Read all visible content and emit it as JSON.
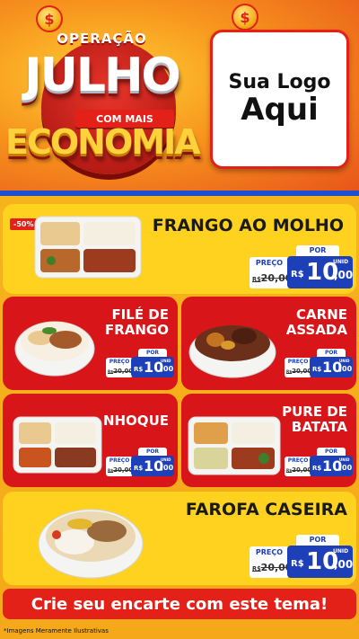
{
  "header": {
    "coin_symbol": "$",
    "logo": {
      "top": "OPERAÇÃO",
      "main": "JULHO",
      "ribbon": "COM MAIS",
      "bottom": "ECONOMIA"
    },
    "brand_box": {
      "line1": "Sua Logo",
      "line2": "Aqui"
    }
  },
  "colors": {
    "accent_red": "#e32119",
    "price_blue": "#1d3fb8",
    "card_yellow": "#ffd21f",
    "card_red": "#d8161a",
    "stripe_blue": "#1f4fd1"
  },
  "products": [
    {
      "name_lines": [
        "FRANGO AO MOLHO"
      ],
      "badge": "-50%",
      "por": "POR",
      "preco": "PREÇO",
      "old_prefix": "R$",
      "old": "20,00",
      "currency": "R$",
      "price": "10",
      "cents": ",00",
      "unit": "UNID"
    },
    {
      "name_lines": [
        "FILÉ DE",
        "FRANGO"
      ],
      "por": "POR",
      "preco": "PREÇO",
      "old_prefix": "R$",
      "old": "20,00",
      "currency": "R$",
      "price": "10",
      "cents": ",00",
      "unit": "UNID"
    },
    {
      "name_lines": [
        "CARNE",
        "ASSADA"
      ],
      "por": "POR",
      "preco": "PREÇO",
      "old_prefix": "R$",
      "old": "20,00",
      "currency": "R$",
      "price": "10",
      "cents": ",00",
      "unit": "UNID"
    },
    {
      "name_lines": [
        "NHOQUE"
      ],
      "por": "POR",
      "preco": "PREÇO",
      "old_prefix": "R$",
      "old": "20,00",
      "currency": "R$",
      "price": "10",
      "cents": ",00",
      "unit": "UNID"
    },
    {
      "name_lines": [
        "PURE DE",
        "BATATA"
      ],
      "por": "POR",
      "preco": "PREÇO",
      "old_prefix": "R$",
      "old": "20,00",
      "currency": "R$",
      "price": "10",
      "cents": ",00",
      "unit": "UNID"
    },
    {
      "name_lines": [
        "FAROFA CASEIRA"
      ],
      "por": "POR",
      "preco": "PREÇO",
      "old_prefix": "R$",
      "old": "20,00",
      "currency": "R$",
      "price": "10",
      "cents": ",00",
      "unit": "UNID"
    }
  ],
  "cta": {
    "label": "Crie seu encarte com este tema!"
  },
  "footer": {
    "note": "*Imagens Meramente Ilustrativas"
  }
}
